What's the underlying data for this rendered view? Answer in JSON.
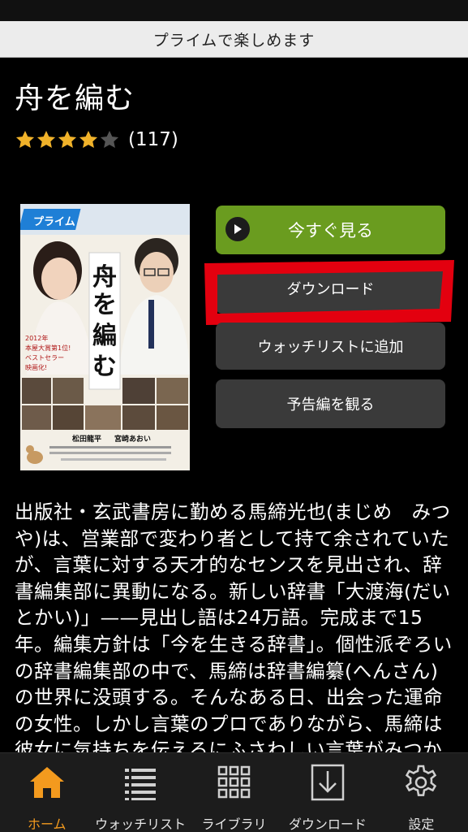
{
  "banner": {
    "text": "プライムで楽しめます"
  },
  "movie": {
    "title": "舟を編む",
    "rating_count": "(117)",
    "rating": 4,
    "rating_max": 5,
    "star_color": "#f0b22a",
    "empty_star_color": "#555555"
  },
  "poster": {
    "badge": "プライム",
    "title": "舟を編む",
    "tagline": "2012年 本屋大賞第1位! ベストセラー 映画化!",
    "actor1": "松田龍平",
    "actor2": "宮崎あおい"
  },
  "buttons": {
    "watch_now": "今すぐ見る",
    "download": "ダウンロード",
    "add_watchlist": "ウォッチリストに追加",
    "trailer": "予告編を観る"
  },
  "description": "出版社・玄武書房に勤める馬締光也(まじめ　みつや)は、営業部で変わり者として持て余されていたが、言葉に対する天才的なセンスを見出され、辞書編集部に異動になる。新しい辞書「大渡海(だいとかい)」——見出し語は24万語。完成まで15年。編集方針は「今を生きる辞書」。個性派ぞろいの辞書編集部の中で、馬締は辞書編纂(へんさん)の世界に没頭する。そんなある日、出会った運命の女性。しかし言葉のプロでありながら、馬締は彼女に気持ちを伝えるにふさわしい言葉がみつからない。問題が山積みの辞書編集部。果たして「大渡",
  "tabs": [
    {
      "label": "ホーム",
      "icon": "home-icon",
      "active": true
    },
    {
      "label": "ウォッチリスト",
      "icon": "list-icon",
      "active": false
    },
    {
      "label": "ライブラリ",
      "icon": "grid-icon",
      "active": false
    },
    {
      "label": "ダウンロード",
      "icon": "download-icon",
      "active": false
    },
    {
      "label": "設定",
      "icon": "gear-icon",
      "active": false
    }
  ],
  "colors": {
    "accent": "#f39a1e",
    "watch_button": "#6a9c1f",
    "button_dark": "#3a3a3a",
    "highlight": "#e3000f"
  }
}
